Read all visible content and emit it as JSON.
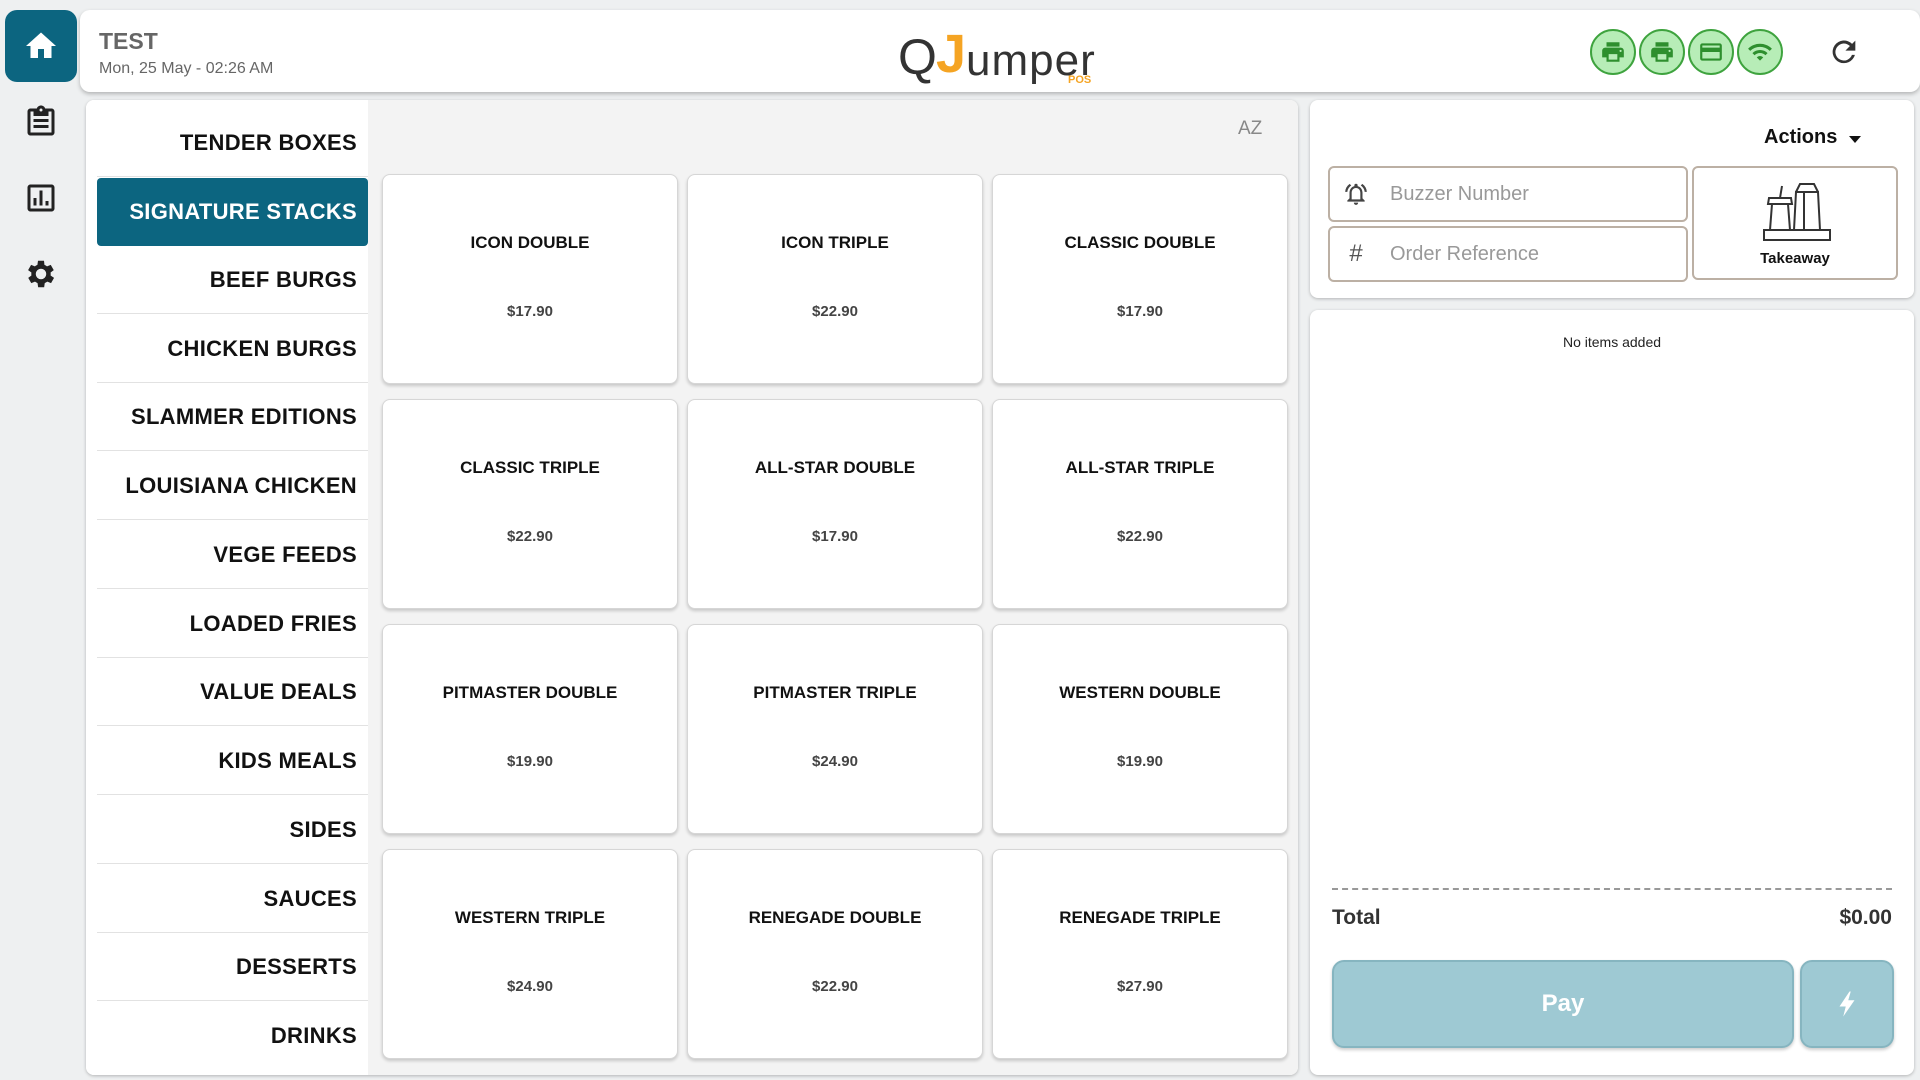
{
  "header": {
    "store_name": "TEST",
    "date_time": "Mon, 25 May - 02:26 AM",
    "logo": {
      "q": "Q",
      "j": "J",
      "rest": "umper",
      "pos": "POS"
    }
  },
  "rail": {
    "items": [
      {
        "icon": "home-icon",
        "active": true
      },
      {
        "icon": "orders-icon",
        "active": false
      },
      {
        "icon": "reports-icon",
        "active": false
      },
      {
        "icon": "settings-icon",
        "active": false
      }
    ]
  },
  "status_icons": [
    "printer-icon",
    "printer-icon",
    "card-icon",
    "wifi-icon"
  ],
  "colors": {
    "primary": "#0c6580",
    "status_green": "#3ea33e",
    "logo_orange": "#f5a423",
    "pay_disabled": "#9ec9d3"
  },
  "categories": [
    {
      "label": "TENDER BOXES",
      "active": false
    },
    {
      "label": "SIGNATURE STACKS",
      "active": true
    },
    {
      "label": "BEEF BURGS",
      "active": false
    },
    {
      "label": "CHICKEN BURGS",
      "active": false
    },
    {
      "label": "SLAMMER EDITIONS",
      "active": false
    },
    {
      "label": "LOUISIANA CHICKEN",
      "active": false
    },
    {
      "label": "VEGE FEEDS",
      "active": false
    },
    {
      "label": "LOADED FRIES",
      "active": false
    },
    {
      "label": "VALUE DEALS",
      "active": false
    },
    {
      "label": "KIDS MEALS",
      "active": false
    },
    {
      "label": "SIDES",
      "active": false
    },
    {
      "label": "SAUCES",
      "active": false
    },
    {
      "label": "DESSERTS",
      "active": false
    },
    {
      "label": "DRINKS",
      "active": false
    }
  ],
  "sort_label": "AZ",
  "products": [
    {
      "name": "ICON DOUBLE",
      "price": "$17.90"
    },
    {
      "name": "ICON TRIPLE",
      "price": "$22.90"
    },
    {
      "name": "CLASSIC DOUBLE",
      "price": "$17.90"
    },
    {
      "name": "CLASSIC TRIPLE",
      "price": "$22.90"
    },
    {
      "name": "ALL-STAR DOUBLE",
      "price": "$17.90"
    },
    {
      "name": "ALL-STAR TRIPLE",
      "price": "$22.90"
    },
    {
      "name": "PITMASTER DOUBLE",
      "price": "$19.90"
    },
    {
      "name": "PITMASTER TRIPLE",
      "price": "$24.90"
    },
    {
      "name": "WESTERN DOUBLE",
      "price": "$19.90"
    },
    {
      "name": "WESTERN TRIPLE",
      "price": "$24.90"
    },
    {
      "name": "RENEGADE DOUBLE",
      "price": "$22.90"
    },
    {
      "name": "RENEGADE TRIPLE",
      "price": "$27.90"
    }
  ],
  "order": {
    "actions_label": "Actions",
    "buzzer_placeholder": "Buzzer Number",
    "reference_placeholder": "Order Reference",
    "buzzer_value": "",
    "reference_value": "",
    "order_type": "Takeaway",
    "empty_message": "No items added",
    "total_label": "Total",
    "total_value": "$0.00",
    "pay_label": "Pay"
  }
}
